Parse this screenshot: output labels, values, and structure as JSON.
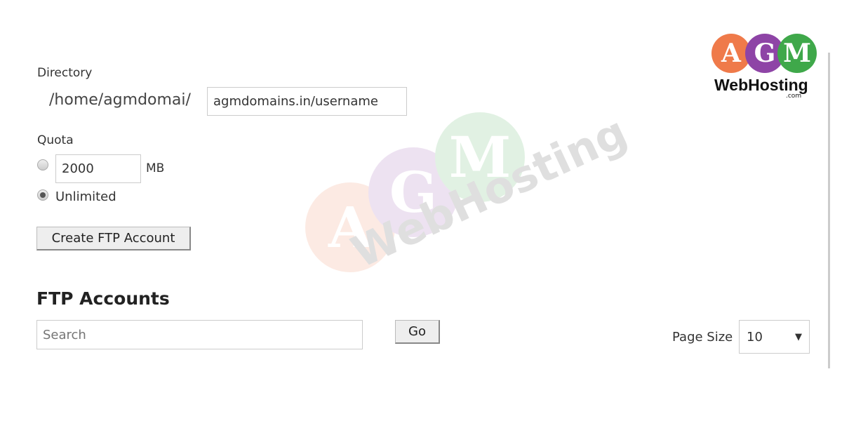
{
  "form": {
    "directory_label": "Directory",
    "directory_prefix": "/home/agmdomai/",
    "directory_value": "agmdomains.in/username",
    "quota_label": "Quota",
    "quota_value": "2000",
    "quota_unit": "MB",
    "unlimited_label": "Unlimited",
    "quota_selected": "Unlimited",
    "create_button": "Create FTP Account"
  },
  "accounts": {
    "heading": "FTP Accounts",
    "search_placeholder": "Search",
    "go_button": "Go",
    "page_size_label": "Page Size",
    "page_size_value": "10"
  },
  "logo": {
    "letters": [
      "A",
      "G",
      "M"
    ],
    "text": "WebHosting",
    "suffix": ".com",
    "colors": [
      "#ef7a4a",
      "#8e44a6",
      "#3fa84a"
    ]
  }
}
